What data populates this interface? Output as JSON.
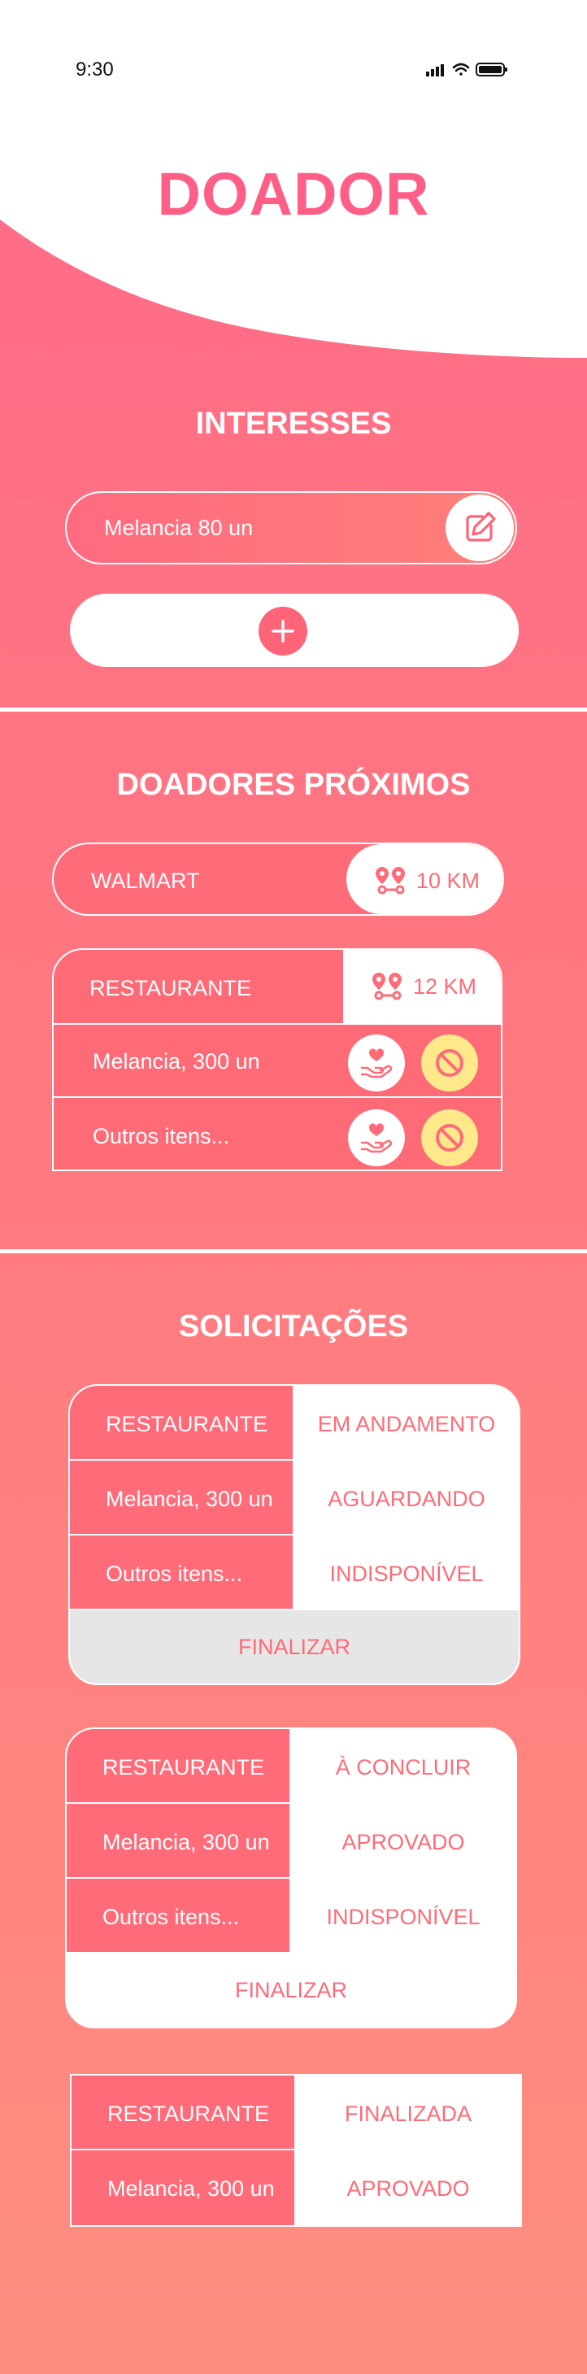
{
  "status_bar": {
    "time": "9:30"
  },
  "app_title": "DOADOR",
  "interesses": {
    "title": "INTERESSES",
    "items": [
      {
        "label": "Melancia 80 un"
      }
    ]
  },
  "doadores": {
    "title": "DOADORES PRÓXIMOS",
    "list": [
      {
        "name": "WALMART",
        "distance": "10 KM"
      }
    ],
    "expanded": {
      "name": "RESTAURANTE",
      "distance": "12 KM",
      "items": [
        {
          "label": "Melancia, 300 un"
        },
        {
          "label": "Outros itens..."
        }
      ]
    }
  },
  "solicitacoes": {
    "title": "SOLICITAÇÕES",
    "cards": [
      {
        "rows": [
          {
            "left": "RESTAURANTE",
            "right": "EM ANDAMENTO"
          },
          {
            "left": "Melancia, 300 un",
            "right": "AGUARDANDO"
          },
          {
            "left": "Outros itens...",
            "right": "INDISPONÍVEL"
          }
        ],
        "action": "FINALIZAR"
      },
      {
        "rows": [
          {
            "left": "RESTAURANTE",
            "right": "À CONCLUIR"
          },
          {
            "left": "Melancia, 300 un",
            "right": "APROVADO"
          },
          {
            "left": "Outros itens...",
            "right": "INDISPONÍVEL"
          }
        ],
        "action": "FINALIZAR"
      },
      {
        "rows": [
          {
            "left": "RESTAURANTE",
            "right": "FINALIZADA"
          },
          {
            "left": "Melancia, 300 un",
            "right": "APROVADO"
          }
        ]
      }
    ]
  },
  "colors": {
    "accent": "#ff6b78",
    "title_pink": "#ff5f87",
    "disabled_button": "#e6e6e6",
    "block_yellow": "#ffe98a"
  },
  "icons": {
    "edit": "edit-icon",
    "add": "plus-icon",
    "location": "map-pin-route-icon",
    "donate": "heart-hand-icon",
    "block": "block-icon"
  }
}
